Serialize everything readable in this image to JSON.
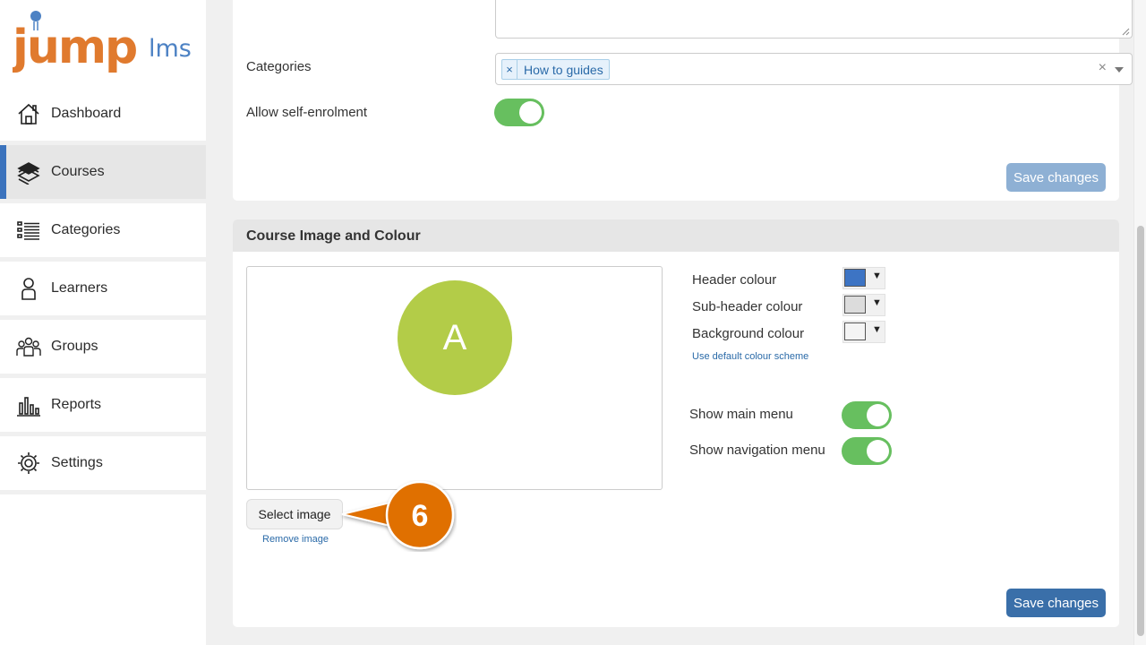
{
  "brand": {
    "name_a": "jump",
    "name_b": "lms",
    "color_orange": "#e07a2e",
    "color_blue": "#4d82c4"
  },
  "sidebar": {
    "items": [
      {
        "label": "Dashboard",
        "icon": "house-icon",
        "active": false
      },
      {
        "label": "Courses",
        "icon": "books-icon",
        "active": true
      },
      {
        "label": "Categories",
        "icon": "list-icon",
        "active": false
      },
      {
        "label": "Learners",
        "icon": "person-icon",
        "active": false
      },
      {
        "label": "Groups",
        "icon": "people-icon",
        "active": false
      },
      {
        "label": "Reports",
        "icon": "bar-chart-icon",
        "active": false
      },
      {
        "label": "Settings",
        "icon": "gear-icon",
        "active": false
      }
    ]
  },
  "details": {
    "categories_label": "Categories",
    "selected_category": "How to guides",
    "tag_remove": "×",
    "clear_symbol": "×",
    "self_enrol_label": "Allow self-enrolment",
    "self_enrol_on": true,
    "save_label": "Save changes"
  },
  "image_colour": {
    "title": "Course Image and Colour",
    "avatar_letter": "A",
    "avatar_color": "#b3cc48",
    "select_image": "Select image",
    "remove_image": "Remove image",
    "header_colour_label": "Header colour",
    "header_colour": "#3d74c4",
    "subheader_colour_label": "Sub-header colour",
    "subheader_colour": "#dcdcdc",
    "background_colour_label": "Background colour",
    "background_colour": "#f4f4f4",
    "dropdown_arrow": "▼",
    "default_scheme": "Use default colour scheme",
    "show_main_menu": "Show main menu",
    "show_main_menu_on": true,
    "show_nav_menu": "Show navigation menu",
    "show_nav_menu_on": true,
    "save_label": "Save changes"
  },
  "callout": {
    "number": "6",
    "color": "#e07000"
  }
}
